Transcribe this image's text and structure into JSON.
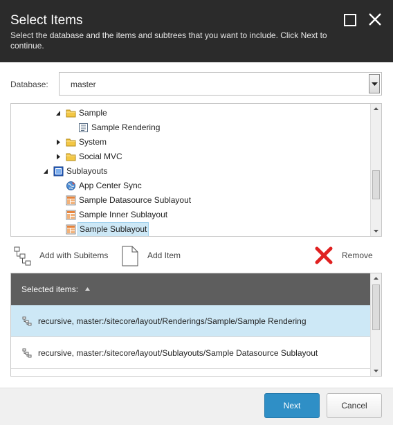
{
  "dialog": {
    "title": "Select Items",
    "subtitle": "Select the database and the items and subtrees that you want to include. Click Next to continue.",
    "maximize_icon": "maximize-icon",
    "close_icon": "close-icon"
  },
  "database": {
    "label": "Database:",
    "value": "master"
  },
  "tree": {
    "items": [
      {
        "label": "Sample",
        "icon": "folder-icon",
        "expander": "expanded"
      },
      {
        "label": "Sample Rendering",
        "icon": "rendering-icon",
        "expander": "none"
      },
      {
        "label": "System",
        "icon": "folder-icon",
        "expander": "collapsed"
      },
      {
        "label": "Social MVC",
        "icon": "folder-icon",
        "expander": "collapsed"
      },
      {
        "label": "Sublayouts",
        "icon": "sublayouts-folder-icon",
        "expander": "expanded"
      },
      {
        "label": "App Center Sync",
        "icon": "globe-icon",
        "expander": "none"
      },
      {
        "label": "Sample Datasource Sublayout",
        "icon": "sublayout-icon",
        "expander": "none"
      },
      {
        "label": "Sample Inner Sublayout",
        "icon": "sublayout-icon",
        "expander": "none"
      },
      {
        "label": "Sample Sublayout",
        "icon": "sublayout-icon",
        "expander": "none",
        "selected": true
      }
    ]
  },
  "toolbar": {
    "add_with_subitems": "Add with Subitems",
    "add_item": "Add Item",
    "remove": "Remove"
  },
  "selected_items": {
    "header": "Selected items:",
    "rows": [
      {
        "text": "recursive, master:/sitecore/layout/Renderings/Sample/Sample Rendering",
        "highlighted": true
      },
      {
        "text": "recursive, master:/sitecore/layout/Sublayouts/Sample Datasource Sublayout",
        "highlighted": false
      }
    ]
  },
  "footer": {
    "next": "Next",
    "cancel": "Cancel"
  },
  "colors": {
    "titlebar": "#2b2b2b",
    "accent": "#2f8fc6",
    "selected_row": "#cde8f6",
    "remove_red": "#e02020"
  }
}
